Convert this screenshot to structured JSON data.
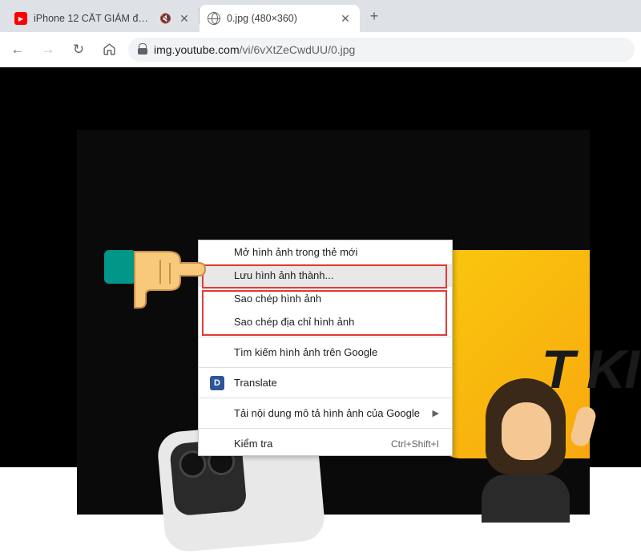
{
  "tabs": [
    {
      "title": "iPhone 12 CẮT GIẢM để TIẾT",
      "active": false,
      "muted": true
    },
    {
      "title": "0.jpg (480×360)",
      "active": true
    }
  ],
  "newTab": "+",
  "nav": {
    "back": "←",
    "forward": "→",
    "reload": "↻",
    "home": "⌂"
  },
  "omnibox": {
    "domain": "img.youtube.com",
    "path": "/vi/6vXtZeCwdUU/0.jpg"
  },
  "thumb": {
    "bigText": "T KI"
  },
  "contextMenu": {
    "items": [
      {
        "label": "Mở hình ảnh trong thẻ mới",
        "hover": false
      },
      {
        "label": "Lưu hình ảnh thành...",
        "hover": true
      },
      {
        "label": "Sao chép hình ảnh",
        "hover": false
      },
      {
        "label": "Sao chép địa chỉ hình ảnh",
        "hover": false
      }
    ],
    "search": "Tìm kiếm hình ảnh trên Google",
    "translate": "Translate",
    "translateBadge": "D",
    "desc": "Tải nội dung mô tả hình ảnh của Google",
    "inspect": "Kiểm tra",
    "inspectShortcut": "Ctrl+Shift+I"
  }
}
